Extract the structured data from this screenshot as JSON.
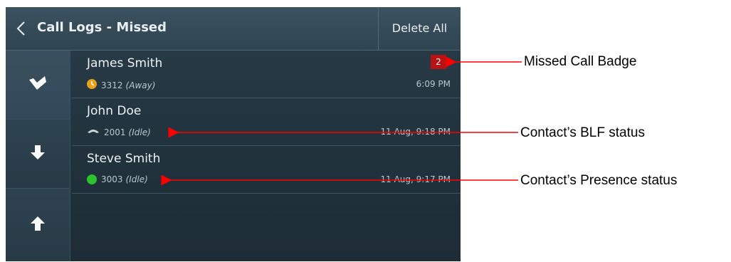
{
  "header": {
    "title": "Call Logs - Missed",
    "delete_all_label": "Delete All",
    "back_icon": "chevron-left-icon"
  },
  "sidebar": {
    "buttons": [
      {
        "icon": "mark-read-check-icon",
        "active": true
      },
      {
        "icon": "arrow-down-icon",
        "active": false
      },
      {
        "icon": "arrow-up-icon",
        "active": false
      }
    ]
  },
  "calls": [
    {
      "name": "James Smith",
      "number": "3312",
      "status": "(Away)",
      "status_icon": "away-clock-icon",
      "time": "6:09 PM",
      "badge": "2"
    },
    {
      "name": "John Doe",
      "number": "2001",
      "status": "(Idle)",
      "status_icon": "handset-icon",
      "time": "11 Aug, 9:18 PM"
    },
    {
      "name": "Steve Smith",
      "number": "3003",
      "status": "(Idle)",
      "status_icon": "presence-available-icon",
      "time": "11 Aug, 9:17 PM"
    }
  ],
  "annotations": {
    "missed_call_badge": "Missed Call Badge",
    "blf_status": "Contact’s BLF status",
    "presence_status": "Contact’s Presence status"
  },
  "colors": {
    "badge": "#b81212",
    "away": "#e8a21a",
    "available": "#2dc12d",
    "annotation_arrow": "#ff0000"
  }
}
